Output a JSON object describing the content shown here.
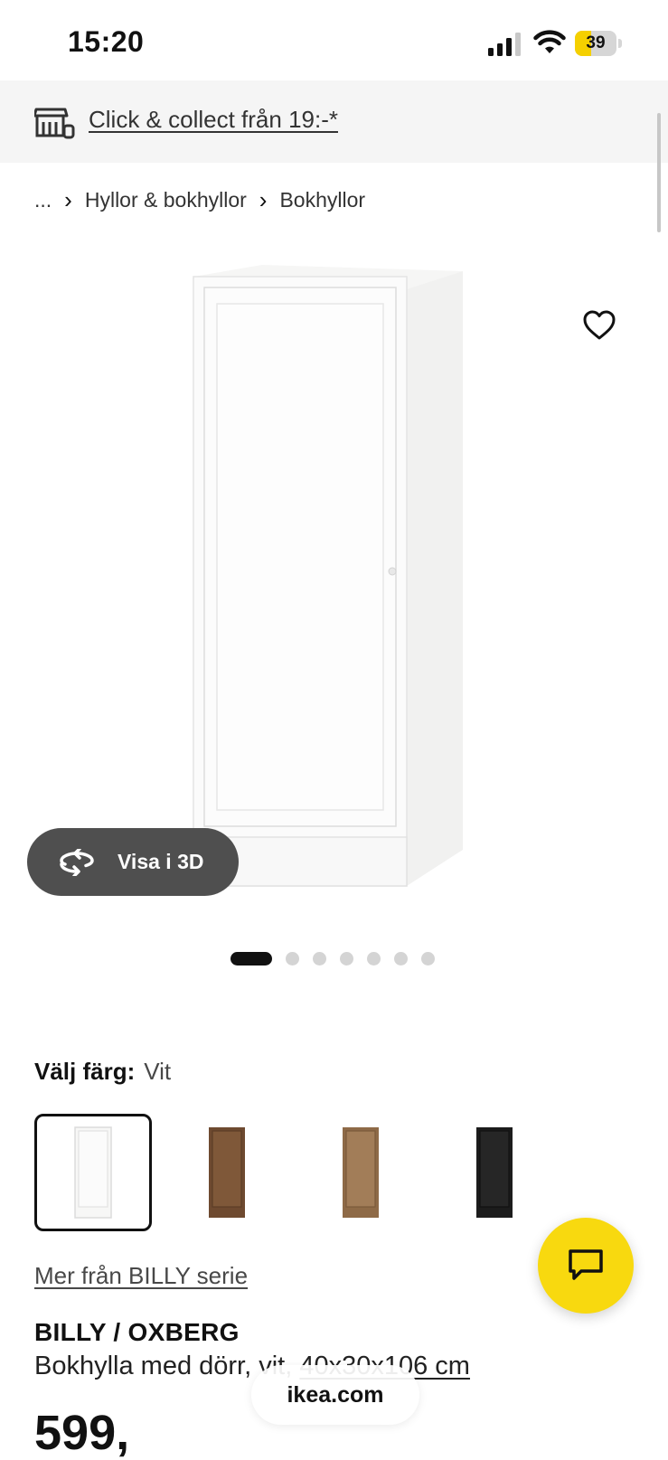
{
  "status_bar": {
    "time": "15:20",
    "battery_level": "39",
    "battery_fraction": 0.39
  },
  "banner": {
    "link": "Click & collect från 19:-*",
    "icon": "store-pickup-icon"
  },
  "breadcrumb": {
    "ellipsis": "...",
    "items": [
      "Hyllor & bokhyllor",
      "Bokhyllor"
    ]
  },
  "gallery": {
    "view_3d_label": "Visa i 3D",
    "image_count": 7,
    "active_index": 0
  },
  "color_select": {
    "label": "Välj färg:",
    "value": "Vit",
    "options": [
      {
        "name": "white",
        "color": "#f4f4f2",
        "selected": true
      },
      {
        "name": "brown-walnut",
        "color": "#7a5236",
        "selected": false
      },
      {
        "name": "oak",
        "color": "#9c7650",
        "selected": false
      },
      {
        "name": "black",
        "color": "#1f1f1f",
        "selected": false
      }
    ]
  },
  "series_link": "Mer från BILLY serie",
  "product": {
    "name": "BILLY / OXBERG",
    "description_prefix": "Bokhylla med dörr, vit, ",
    "description_size": "40x30x106 cm",
    "price": "599,"
  },
  "browser": {
    "url": "ikea.com"
  },
  "colors": {
    "accent_yellow": "#f8d90f",
    "dark_button": "#4f4f4f",
    "banner_bg": "#f5f5f5"
  }
}
